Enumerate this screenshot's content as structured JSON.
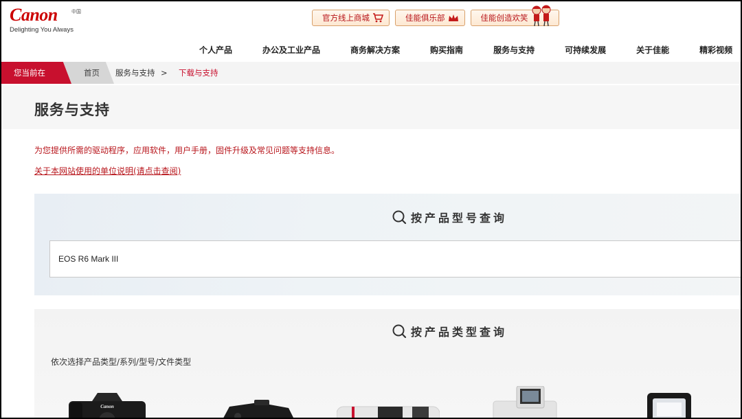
{
  "header": {
    "logo": "Canon",
    "region": "中国",
    "tagline": "Delighting You Always",
    "top_links": [
      {
        "label": "官方线上商城",
        "icon": "shopping-cart-icon"
      },
      {
        "label": "佳能俱乐部",
        "icon": "crown-icon"
      },
      {
        "label": "佳能创造欢笑",
        "icon": "mascot-icon"
      }
    ]
  },
  "nav": {
    "items": [
      "个人产品",
      "办公及工业产品",
      "商务解决方案",
      "购买指南",
      "服务与支持",
      "可持续发展",
      "关于佳能",
      "精彩视频"
    ]
  },
  "breadcrumb": {
    "here_label": "您当前在",
    "home": "首页",
    "section": "服务与支持",
    "separator": ">",
    "current": "下载与支持"
  },
  "page": {
    "title": "服务与支持",
    "intro": "为您提供所需的驱动程序，应用软件，用户手册，固件升级及常见问题等支持信息。",
    "unit_link": "关于本网站使用的单位说明(请点击查阅)"
  },
  "model_search": {
    "title": "按产品型号查询",
    "value": "EOS R6 Mark III"
  },
  "type_search": {
    "title": "按产品类型查询",
    "hint": "依次选择产品类型/系列/型号/文件类型",
    "camera_brand": "Canon"
  },
  "colors": {
    "brand_red": "#cc0000",
    "crumb_red": "#c8102e",
    "link_red": "#b8161c"
  }
}
